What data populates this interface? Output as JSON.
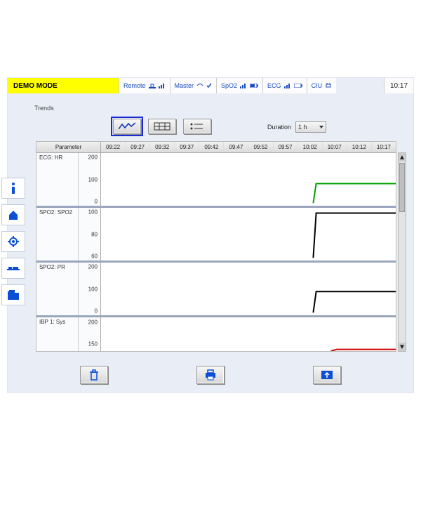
{
  "topbar": {
    "demo_mode": "DEMO MODE",
    "segments": [
      {
        "label": "Remote"
      },
      {
        "label": "Master"
      },
      {
        "label": "SpO2"
      },
      {
        "label": "ECG"
      },
      {
        "label": "CIU"
      }
    ],
    "clock": "10:17"
  },
  "title": "Trends",
  "view_buttons": {
    "graph": "graph-view",
    "table": "table-view",
    "list": "list-view"
  },
  "duration": {
    "label": "Duration",
    "value": "1 h"
  },
  "timeline": [
    "09:22",
    "09:27",
    "09:32",
    "09:37",
    "09:42",
    "09:47",
    "09:52",
    "09:57",
    "10:02",
    "10:07",
    "10:12",
    "10:17"
  ],
  "param_header": "Parameter",
  "chart_data": [
    {
      "type": "line",
      "parameter": "ECG: HR",
      "ylim": [
        0,
        200
      ],
      "yticks": [
        0,
        100,
        200
      ],
      "color": "#00a000",
      "series": [
        {
          "name": "HR",
          "x": [
            "10:02",
            "10:03",
            "10:17"
          ],
          "values": [
            0,
            75,
            75
          ]
        }
      ]
    },
    {
      "type": "line",
      "parameter": "SPO2: SPO2",
      "ylim": [
        60,
        100
      ],
      "yticks": [
        60,
        80,
        100
      ],
      "color": "#000000",
      "series": [
        {
          "name": "SpO2",
          "x": [
            "10:02",
            "10:03",
            "10:17"
          ],
          "values": [
            60,
            98,
            98
          ]
        }
      ]
    },
    {
      "type": "line",
      "parameter": "SPO2: PR",
      "ylim": [
        0,
        200
      ],
      "yticks": [
        0,
        100,
        200
      ],
      "color": "#000000",
      "series": [
        {
          "name": "PR",
          "x": [
            "10:02",
            "10:03",
            "10:17"
          ],
          "values": [
            0,
            80,
            80
          ]
        }
      ]
    },
    {
      "type": "line",
      "parameter": "IBP 1: Sys",
      "ylim": [
        100,
        200
      ],
      "yticks": [
        150,
        200
      ],
      "color": "#d00000",
      "series": [
        {
          "name": "Sys",
          "x": [
            "10:07",
            "10:08",
            "10:17"
          ],
          "values": [
            100,
            130,
            130
          ]
        }
      ]
    }
  ],
  "sidebar_icons": [
    "info-icon",
    "home-icon",
    "gear-icon",
    "bed-icon",
    "folder-icon"
  ],
  "bottom_icons": [
    "trash-icon",
    "print-icon",
    "export-icon"
  ]
}
